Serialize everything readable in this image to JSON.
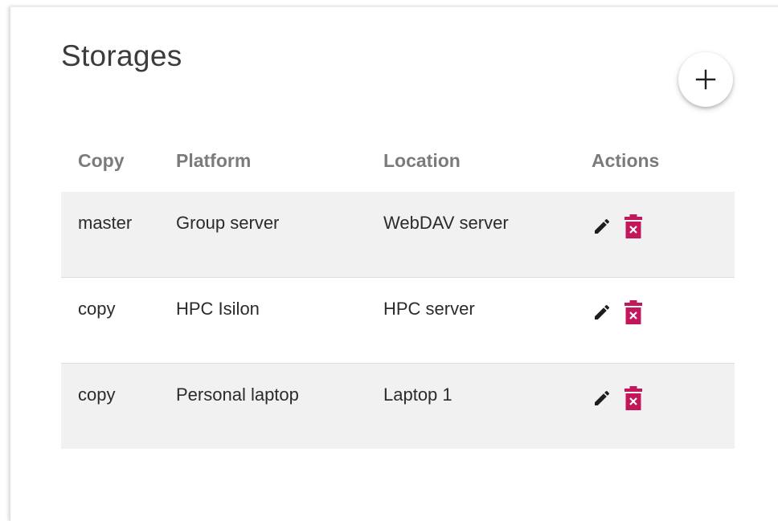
{
  "page": {
    "title": "Storages"
  },
  "toolbar": {
    "add_icon": "plus-icon"
  },
  "table": {
    "headers": {
      "copy": "Copy",
      "platform": "Platform",
      "location": "Location",
      "actions": "Actions"
    },
    "rows": [
      {
        "copy": "master",
        "platform": "Group server",
        "location": "WebDAV server"
      },
      {
        "copy": "copy",
        "platform": "HPC Isilon",
        "location": "HPC server"
      },
      {
        "copy": "copy",
        "platform": "Personal laptop",
        "location": "Laptop 1"
      }
    ],
    "row_actions": {
      "edit_icon": "pencil-icon",
      "delete_icon": "trash-icon"
    }
  },
  "colors": {
    "title_text": "#3c3c3c",
    "header_text": "#7b7b7b",
    "row_shade": "#f1f1f1",
    "edit_icon": "#1e1e1e",
    "delete_icon": "#c2185b"
  }
}
